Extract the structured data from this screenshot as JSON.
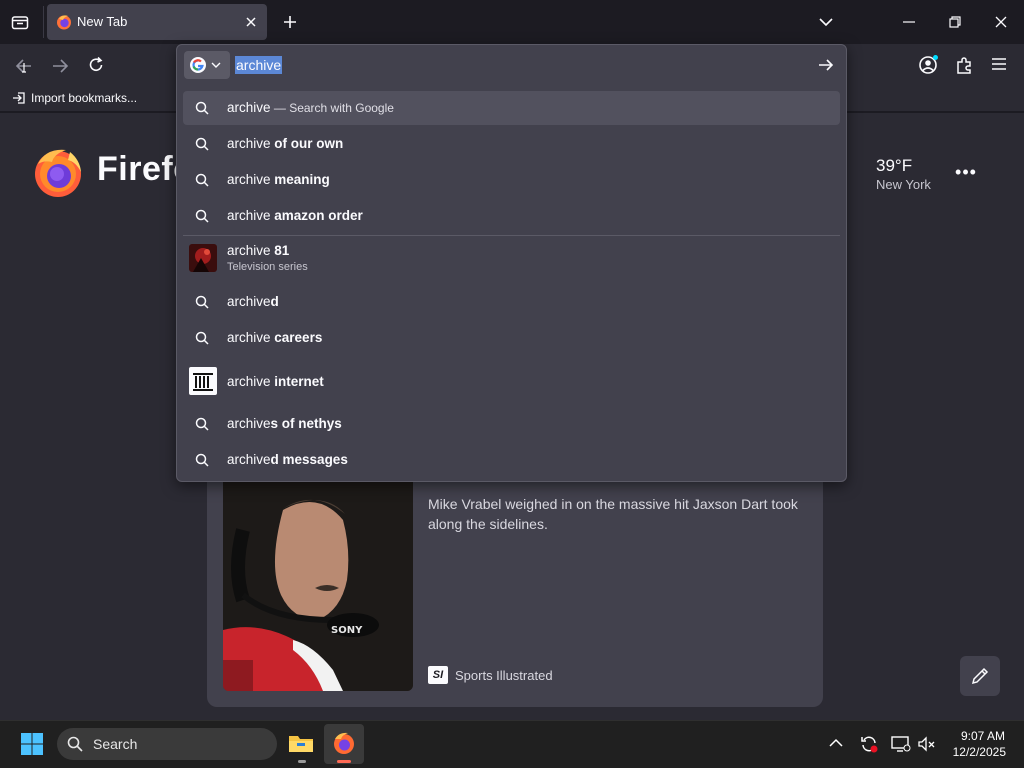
{
  "tabs": [
    {
      "label": "New Tab"
    }
  ],
  "bookmarks": {
    "import_label": "Import bookmarks..."
  },
  "brand": {
    "wordmark": "Firefo"
  },
  "weather": {
    "temp": "39°F",
    "city": "New York"
  },
  "urlbar": {
    "value": "archive",
    "suggestions": [
      {
        "prefix": "archive",
        "bold": "",
        "extra": " — Search with Google",
        "icon": "search-icon",
        "selected": true
      },
      {
        "prefix": "archive ",
        "bold": "of our own",
        "icon": "search-icon"
      },
      {
        "prefix": "archive ",
        "bold": "meaning",
        "icon": "search-icon"
      },
      {
        "prefix": "archive ",
        "bold": "amazon order",
        "icon": "search-icon"
      },
      {
        "prefix": "archive ",
        "bold": "81",
        "subtitle": "Television series",
        "icon": "thumbnail"
      },
      {
        "prefix": "archive",
        "bold": "d",
        "icon": "search-icon"
      },
      {
        "prefix": "archive ",
        "bold": "careers",
        "icon": "search-icon"
      },
      {
        "prefix": "archive ",
        "bold": "internet",
        "icon": "archive-logo"
      },
      {
        "prefix": "archive",
        "bold": "s of nethys",
        "icon": "search-icon"
      },
      {
        "prefix": "archive",
        "bold": "d messages",
        "icon": "search-icon"
      }
    ]
  },
  "story": {
    "text": "Mike Vrabel weighed in on the massive hit Jaxson Dart took along the sidelines.",
    "source": "Sports Illustrated",
    "source_badge": "SI",
    "photo_caption": "SONY"
  },
  "taskbar": {
    "search_label": "Search",
    "time": "9:07 AM",
    "date": "12/2/2025"
  },
  "colors": {
    "accent": "#5c88d6",
    "page_bg": "#2b2a33",
    "chrome_bg": "#1c1b22"
  }
}
